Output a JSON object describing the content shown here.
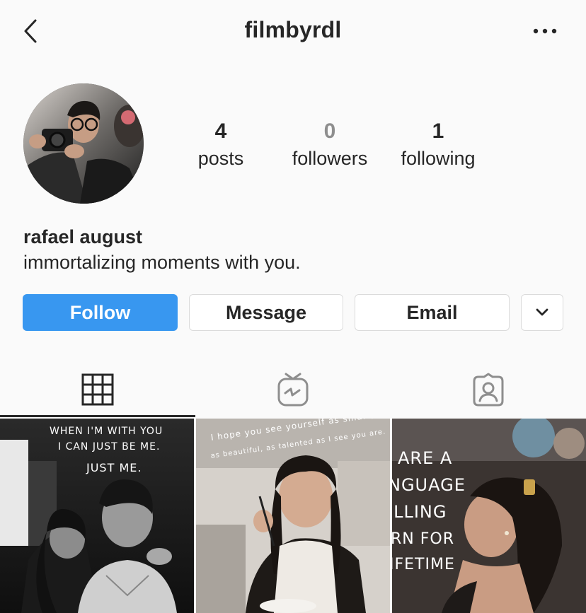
{
  "header": {
    "username": "filmbyrdl",
    "back_icon": "chevron-left-icon",
    "more_icon": "more-horizontal-icon"
  },
  "profile": {
    "stats": [
      {
        "count": "4",
        "label": "posts"
      },
      {
        "count": "0",
        "label": "followers"
      },
      {
        "count": "1",
        "label": "following"
      }
    ],
    "full_name": "rafael august",
    "bio": "immortalizing moments with you."
  },
  "actions": {
    "follow_label": "Follow",
    "message_label": "Message",
    "email_label": "Email",
    "dropdown_icon": "chevron-down-icon"
  },
  "tabs": [
    {
      "icon": "grid-icon",
      "active": true
    },
    {
      "icon": "igtv-icon",
      "active": false
    },
    {
      "icon": "tagged-icon",
      "active": false
    }
  ],
  "posts": [
    {
      "caption_lines": [
        "WHEN I'M WITH YOU",
        "I CAN JUST BE ME.",
        "JUST ME."
      ]
    },
    {
      "caption_lines": [
        "I hope you see yourself as smart,",
        "as beautiful, as talented as I see you are."
      ]
    },
    {
      "caption_lines": [
        "ARE A",
        "NGUAGE",
        "ILLING",
        "RN FOR",
        "IFETIME"
      ]
    }
  ],
  "colors": {
    "accent": "#3897f0",
    "text": "#262626",
    "muted": "#8e8e8e",
    "border": "#dbdbdb",
    "background": "#fafafa"
  }
}
